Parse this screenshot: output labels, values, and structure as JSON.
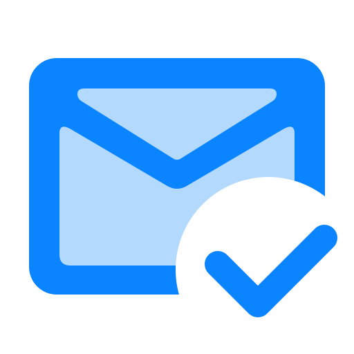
{
  "icon": {
    "name": "mail-check-icon",
    "parts": [
      "envelope-icon",
      "checkmark-icon"
    ]
  },
  "colors": {
    "primary": "#0A84FF",
    "light": "#B3DAFD",
    "background": "#FFFFFF"
  }
}
